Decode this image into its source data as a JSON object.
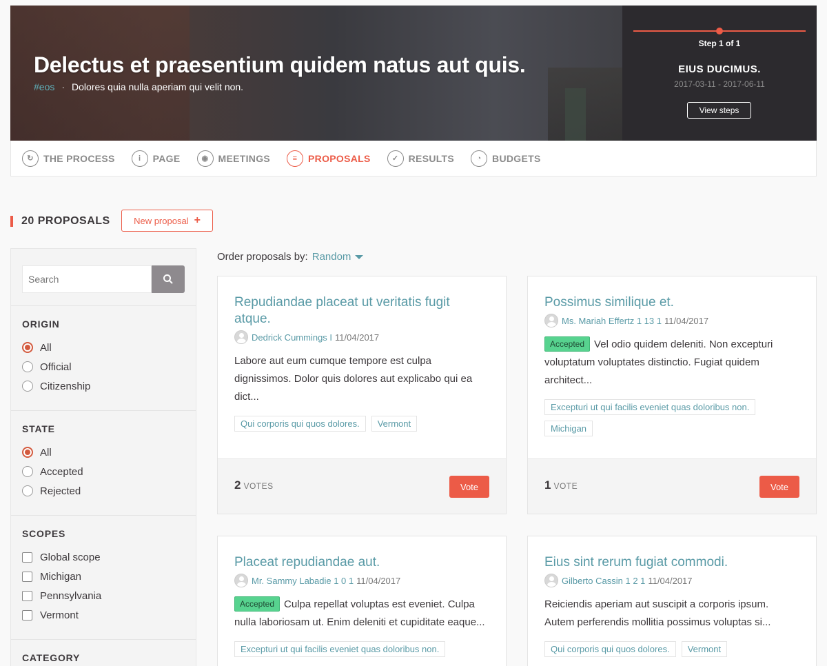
{
  "hero": {
    "title": "Delectus et praesentium quidem natus aut quis.",
    "hashtag": "#eos",
    "subtitle": "Dolores quia nulla aperiam qui velit non.",
    "step_label": "Step 1 of 1",
    "phase_title": "EIUS DUCIMUS.",
    "phase_dates": "2017-03-11 - 2017-06-11",
    "view_steps": "View steps"
  },
  "tabs": [
    {
      "label": "THE PROCESS",
      "icon": "process-icon",
      "glyph": "↻"
    },
    {
      "label": "PAGE",
      "icon": "info-icon",
      "glyph": "i"
    },
    {
      "label": "MEETINGS",
      "icon": "location-pin-icon",
      "glyph": "◉"
    },
    {
      "label": "PROPOSALS",
      "icon": "proposals-icon",
      "glyph": "≡"
    },
    {
      "label": "RESULTS",
      "icon": "check-icon",
      "glyph": "✓"
    },
    {
      "label": "BUDGETS",
      "icon": "pie-chart-icon",
      "glyph": "◔"
    }
  ],
  "proposals_header": {
    "count_title": "20 PROPOSALS",
    "new_proposal": "New proposal",
    "plus": "+"
  },
  "sidebar": {
    "search_placeholder": "Search",
    "origin": {
      "title": "ORIGIN",
      "options": [
        "All",
        "Official",
        "Citizenship"
      ],
      "selected": "All"
    },
    "state": {
      "title": "STATE",
      "options": [
        "All",
        "Accepted",
        "Rejected"
      ],
      "selected": "All"
    },
    "scopes": {
      "title": "SCOPES",
      "options": [
        "Global scope",
        "Michigan",
        "Pennsylvania",
        "Vermont"
      ]
    },
    "category": {
      "title": "CATEGORY"
    }
  },
  "order": {
    "label": "Order proposals by:",
    "selected": "Random"
  },
  "cards": [
    {
      "title": "Repudiandae placeat ut veritatis fugit atque.",
      "author": "Dedrick Cummings I",
      "date": "11/04/2017",
      "badge": "",
      "description": "Labore aut eum cumque tempore est culpa dignissimos. Dolor quis dolores aut explicabo qui ea dict...",
      "tags": [
        "Qui corporis qui quos dolores.",
        "Vermont"
      ],
      "votes": "2",
      "votes_label": "VOTES",
      "vote_button": "Vote"
    },
    {
      "title": "Possimus similique et.",
      "author": "Ms. Mariah Effertz 1 13 1",
      "date": "11/04/2017",
      "badge": "Accepted",
      "description": "Vel odio quidem deleniti. Non excepturi voluptatum voluptates distinctio. Fugiat quidem architect...",
      "tags": [
        "Excepturi ut qui facilis eveniet quas doloribus non.",
        "Michigan"
      ],
      "votes": "1",
      "votes_label": "VOTE",
      "vote_button": "Vote"
    },
    {
      "title": "Placeat repudiandae aut.",
      "author": "Mr. Sammy Labadie 1 0 1",
      "date": "11/04/2017",
      "badge": "Accepted",
      "description": "Culpa repellat voluptas est eveniet. Culpa nulla laboriosam ut. Enim deleniti et cupiditate eaque...",
      "tags": [
        "Excepturi ut qui facilis eveniet quas doloribus non."
      ]
    },
    {
      "title": "Eius sint rerum fugiat commodi.",
      "author": "Gilberto Cassin 1 2 1",
      "date": "11/04/2017",
      "badge": "",
      "description": "Reiciendis aperiam aut suscipit a corporis ipsum. Autem perferendis mollitia possimus voluptas si...",
      "tags": [
        "Qui corporis qui quos dolores.",
        "Vermont"
      ]
    }
  ],
  "colors": {
    "accent": "#ec5b47",
    "link": "#599aa6",
    "accepted": "#57d38f"
  }
}
